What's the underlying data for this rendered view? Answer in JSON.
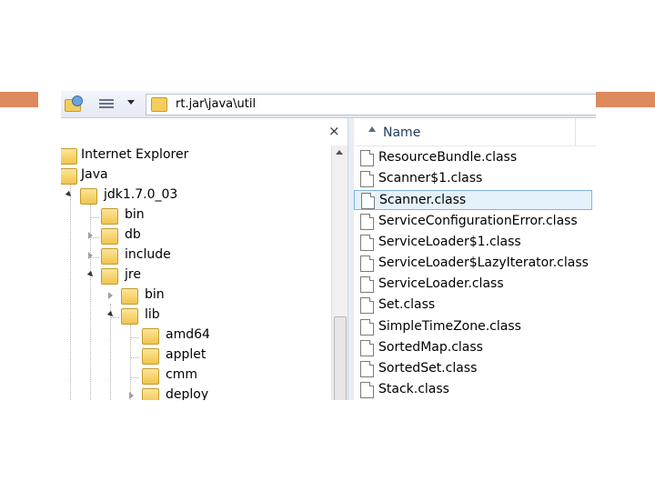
{
  "colors": {
    "slide_accent": "#dd8a5e",
    "selection": "#e5f1fb",
    "folder": "#f4cd5d"
  },
  "toolbar": {
    "organize_icon": "organize-icon",
    "views_icon": "views-icon",
    "address_path": "rt.jar\\java\\util"
  },
  "nav_pane": {
    "close_label": "×",
    "items": [
      {
        "label": "Internet Explorer"
      },
      {
        "label": "Java"
      },
      {
        "label": "jdk1.7.0_03"
      },
      {
        "label": "bin"
      },
      {
        "label": "db"
      },
      {
        "label": "include"
      },
      {
        "label": "jre"
      },
      {
        "label": "bin"
      },
      {
        "label": "lib"
      },
      {
        "label": "amd64"
      },
      {
        "label": "applet"
      },
      {
        "label": "cmm"
      },
      {
        "label": "deploy"
      }
    ]
  },
  "file_list": {
    "column_name": "Name",
    "files": [
      "ResourceBundle.class",
      "Scanner$1.class",
      "Scanner.class",
      "ServiceConfigurationError.class",
      "ServiceLoader$1.class",
      "ServiceLoader$LazyIterator.class",
      "ServiceLoader.class",
      "Set.class",
      "SimpleTimeZone.class",
      "SortedMap.class",
      "SortedSet.class",
      "Stack.class"
    ],
    "selected": "Scanner.class"
  }
}
